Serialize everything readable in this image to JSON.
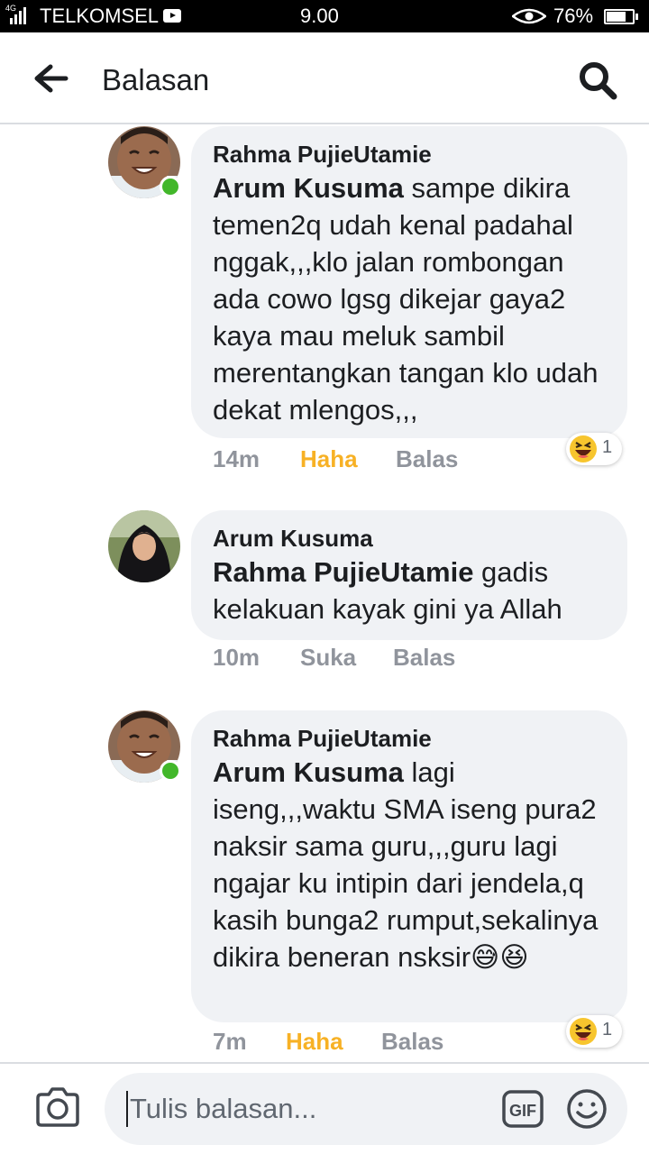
{
  "status_bar": {
    "network": "4G",
    "carrier": "TELKOMSEL",
    "time": "9.00",
    "battery": "76%"
  },
  "header": {
    "title": "Balasan"
  },
  "comments": [
    {
      "author": "Rahma PujieUtamie",
      "mention": "Arum Kusuma",
      "body": " sampe dikira temen2q udah kenal padahal nggak,,,klo jalan rombongan ada cowo lgsg dikejar gaya2 kaya mau meluk sambil merentangkan tangan klo udah dekat mlengos,,,",
      "time": "14m",
      "reaction_label": "Haha",
      "reply_label": "Balas",
      "reaction_count": "1",
      "online": true
    },
    {
      "author": "Arum Kusuma",
      "mention": "Rahma PujieUtamie",
      "body": " gadis kelakuan kayak gini ya Allah",
      "time": "10m",
      "reaction_label": "Suka",
      "reply_label": "Balas",
      "online": false
    },
    {
      "author": "Rahma PujieUtamie",
      "mention": "Arum Kusuma",
      "body": " lagi iseng,,,waktu SMA iseng pura2 naksir sama guru,,,guru lagi ngajar ku intipin dari jendela,q kasih bunga2 rumput,sekalinya dikira beneran nsksir😅😆",
      "time": "7m",
      "reaction_label": "Haha",
      "reply_label": "Balas",
      "reaction_count": "1",
      "online": true
    }
  ],
  "compose": {
    "placeholder": "Tulis balasan..."
  },
  "icons": {
    "back": "arrow-left-icon",
    "search": "magnifier-icon",
    "camera": "camera-icon",
    "gif": "gif-icon",
    "emoji": "smiley-icon",
    "haha": "laughing-face-icon"
  },
  "colors": {
    "bubble": "#f0f2f5",
    "haha_accent": "#f7b125",
    "online": "#42b72a",
    "meta_text": "#90949c"
  }
}
